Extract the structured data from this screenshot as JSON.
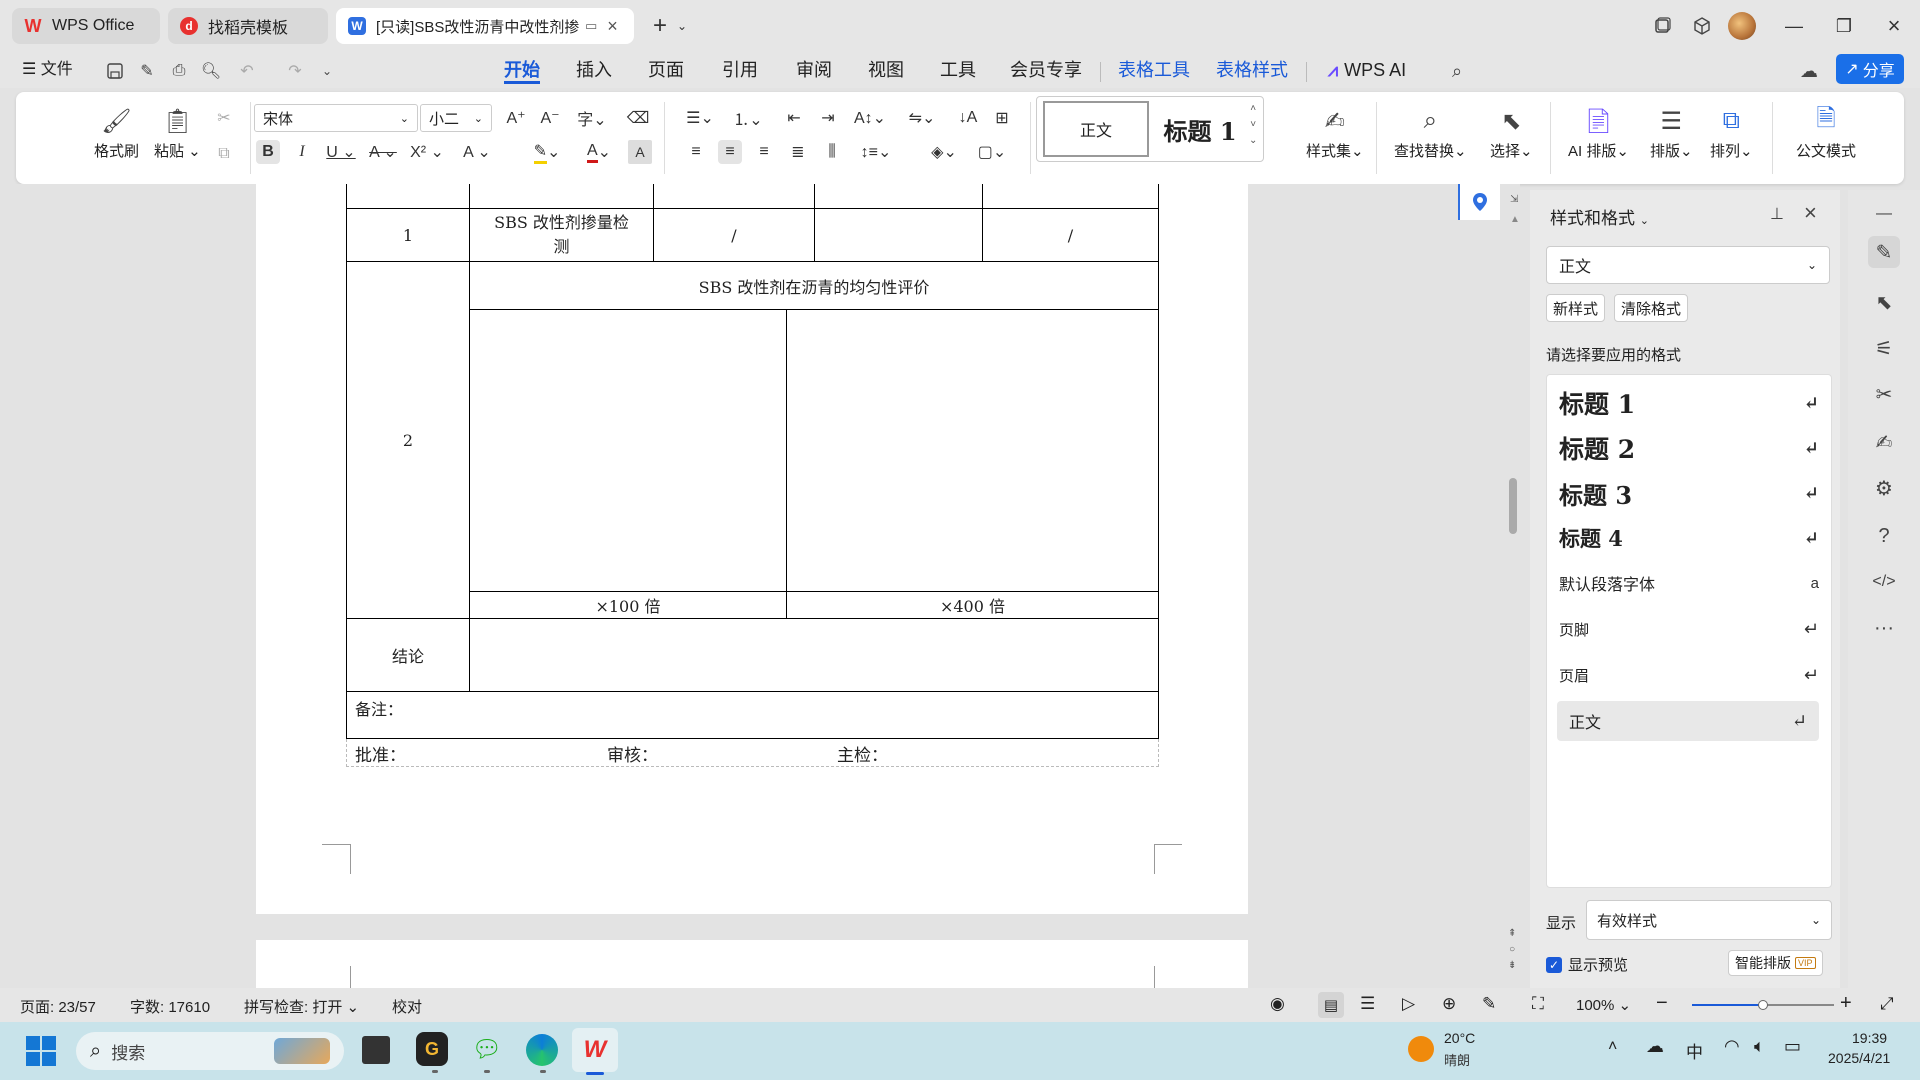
{
  "tabs": [
    {
      "label": "WPS Office",
      "icon": "wps-logo-icon"
    },
    {
      "label": "找稻壳模板",
      "icon": "docer-icon"
    },
    {
      "label": "[只读]SBS改性沥青中改性剂掺",
      "icon": "word-doc-icon"
    }
  ],
  "menu": {
    "file": "文件",
    "items": [
      "开始",
      "插入",
      "页面",
      "引用",
      "审阅",
      "视图",
      "工具",
      "会员专享"
    ],
    "contextual": [
      "表格工具",
      "表格样式"
    ],
    "wps_ai": "WPS AI",
    "share": "分享"
  },
  "ribbon": {
    "format_painter": "格式刷",
    "paste": "粘贴",
    "font_name": "宋体",
    "font_size": "小二",
    "style_normal": "正文",
    "style_heading": "标题 1",
    "style_set": "样式集",
    "find_replace": "查找替换",
    "select": "选择",
    "ai_layout": "AI 排版",
    "layout": "排版",
    "arrange": "排列",
    "official_mode": "公文模式"
  },
  "document": {
    "row1_num": "1",
    "row1_item": "SBS 改性剂掺量检测",
    "row1_c3": "/",
    "row1_c5": "/",
    "row2_num": "2",
    "row2_title": "SBS 改性剂在沥青的均匀性评价",
    "mag_100": "×100 倍",
    "mag_400": "×400 倍",
    "conclusion": "结论",
    "remarks": "备注：",
    "approve": "批准：",
    "review": "审核：",
    "inspector": "主检："
  },
  "panel": {
    "title": "样式和格式",
    "current_style": "正文",
    "new_style": "新样式",
    "clear_format": "清除格式",
    "apply_prompt": "请选择要应用的格式",
    "styles": [
      {
        "label": "标题  1",
        "mark": "↵"
      },
      {
        "label": "标题  2",
        "mark": "↵"
      },
      {
        "label": "标题  3",
        "mark": "↵"
      },
      {
        "label": "标题  4",
        "mark": "↵"
      },
      {
        "label": "默认段落字体",
        "mark": "a"
      },
      {
        "label": "页脚",
        "mark": "↵"
      },
      {
        "label": "页眉",
        "mark": "↵"
      },
      {
        "label": "正文",
        "mark": "↵"
      }
    ],
    "show_label": "显示",
    "show_value": "有效样式",
    "show_preview": "显示预览",
    "smart_layout": "智能排版",
    "vip": "VIP"
  },
  "status": {
    "page": "页面: 23/57",
    "words": "字数: 17610",
    "spell": "拼写检查: 打开",
    "proof": "校对",
    "zoom": "100%",
    "zoom_level": 0.5
  },
  "taskbar": {
    "search": "搜索",
    "temp": "20°C",
    "weather": "晴朗",
    "ime": "中",
    "time": "19:39",
    "date": "2025/4/21"
  },
  "colors": {
    "accent": "#1a5ad8",
    "wps_red": "#e8312f"
  }
}
